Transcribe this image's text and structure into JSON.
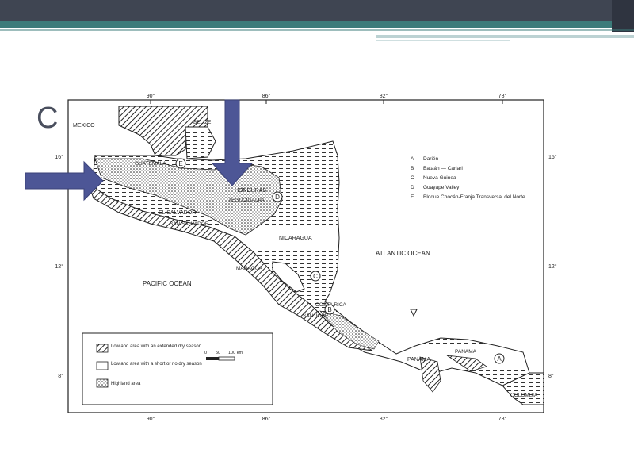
{
  "slide": {
    "letter": "C"
  },
  "map": {
    "countries": {
      "mexico": "MEXICO",
      "belize": "BELIZE",
      "guatemala": "GUATEMALA",
      "honduras": "HONDURAS",
      "el_salvador": "EL SALVADOR",
      "nicaragua": "NICARAGUA",
      "costa_rica": "COSTA RICA",
      "panama": "PANAMA",
      "colombia": "COLOMBIA"
    },
    "cities": {
      "tegucigalpa": "TEGUCIGALPA",
      "san_salvador": "SAN SALVADOR",
      "managua": "MANAGUA",
      "san_jose": "SAN JOSE",
      "panama_city": "PANAMA"
    },
    "oceans": {
      "atlantic": "ATLANTIC OCEAN",
      "pacific": "PACIFIC OCEAN"
    },
    "ticks_top": [
      "90°",
      "86°",
      "82°",
      "78°"
    ],
    "ticks_bottom": [
      "90°",
      "86°",
      "82°",
      "78°"
    ],
    "ticks_left": [
      "16°",
      "12°",
      "8°"
    ],
    "ticks_right": [
      "16°",
      "12°",
      "8°"
    ],
    "site_key": [
      {
        "marker": "A",
        "label": "Darién"
      },
      {
        "marker": "B",
        "label": "Bataán — Cariari"
      },
      {
        "marker": "C",
        "label": "Nueva Guinea"
      },
      {
        "marker": "D",
        "label": "Guayape Valley"
      },
      {
        "marker": "E",
        "label": "Bloque Chocán-Franja Transversal del Norte"
      }
    ],
    "legend": [
      {
        "pattern": "hatch",
        "label": "Lowland area with an extended dry season"
      },
      {
        "pattern": "dash",
        "label": "Lowland area with a short or no dry season"
      },
      {
        "pattern": "dots",
        "label": "Highland area"
      }
    ],
    "scale": {
      "labels": [
        "0",
        "50",
        "100 km"
      ]
    }
  },
  "colors": {
    "arrow": "#4d5696",
    "topbar": "#3f4552",
    "teal": "#3c7b7a"
  }
}
